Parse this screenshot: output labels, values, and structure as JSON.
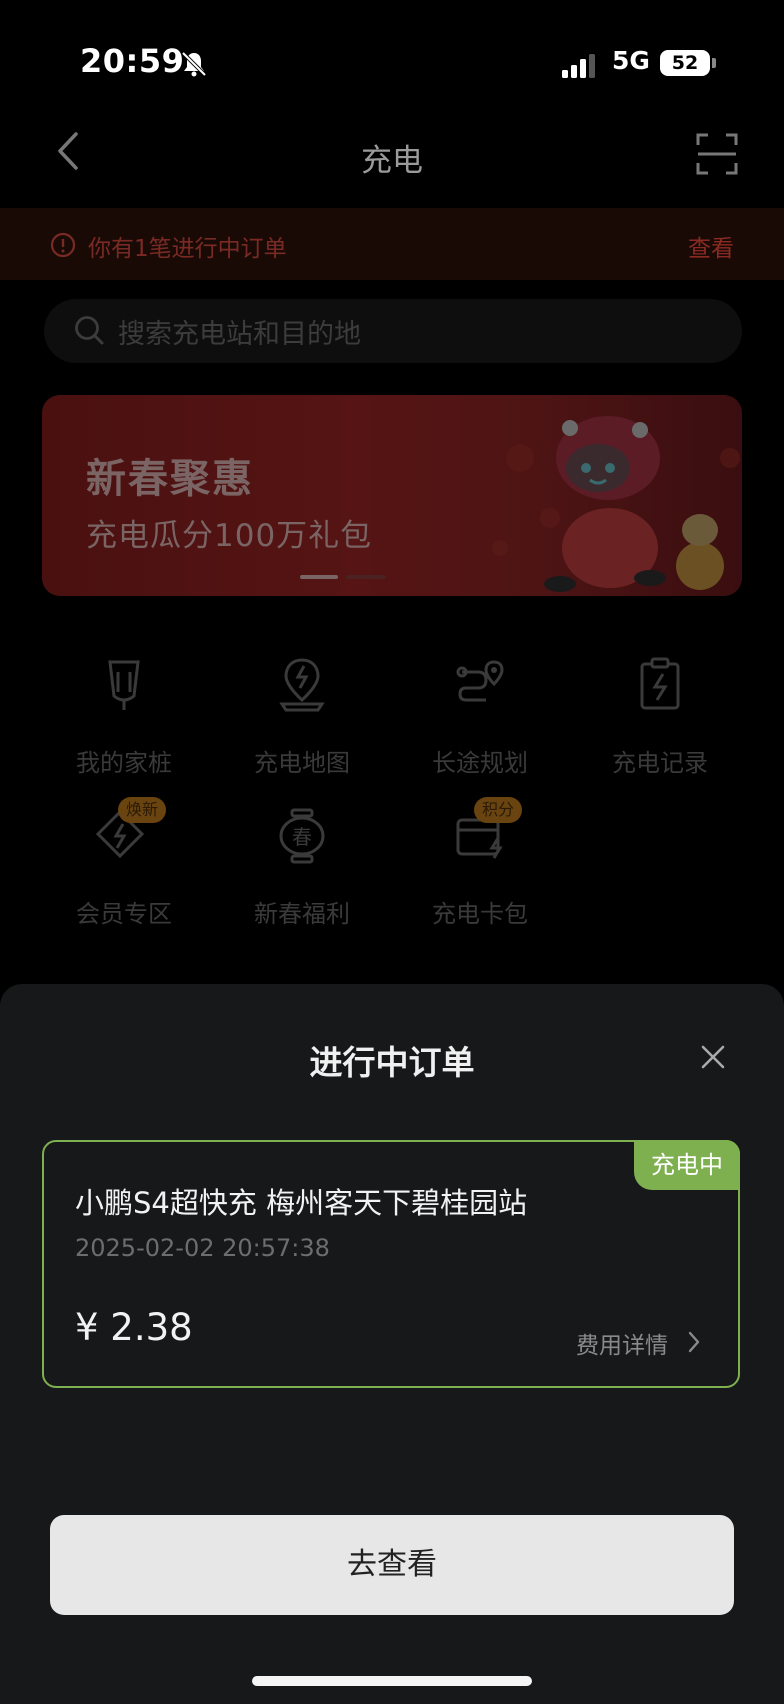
{
  "status": {
    "time": "20:59",
    "network": "5G",
    "battery": "52"
  },
  "header": {
    "title": "充电"
  },
  "notice": {
    "text": "你有1笔进行中订单",
    "link": "查看"
  },
  "search": {
    "placeholder": "搜索充电站和目的地"
  },
  "banner": {
    "title": "新春聚惠",
    "subtitle": "充电瓜分100万礼包"
  },
  "grid": {
    "items": [
      {
        "label": "我的家桩",
        "icon": "home-charger-icon"
      },
      {
        "label": "充电地图",
        "icon": "charging-map-icon"
      },
      {
        "label": "长途规划",
        "icon": "route-plan-icon"
      },
      {
        "label": "充电记录",
        "icon": "charging-record-icon"
      },
      {
        "label": "会员专区",
        "icon": "member-icon",
        "tag": "焕新"
      },
      {
        "label": "新春福利",
        "icon": "spring-lantern-icon"
      },
      {
        "label": "充电卡包",
        "icon": "card-wallet-icon",
        "tag": "积分"
      }
    ]
  },
  "sheet": {
    "title": "进行中订单",
    "order": {
      "status": "充电中",
      "station": "小鹏S4超快充 梅州客天下碧桂园站",
      "time": "2025-02-02 20:57:38",
      "price": "¥ 2.38",
      "detail_link": "费用详情"
    },
    "button": "去查看"
  },
  "colors": {
    "accent_green": "#7fb050",
    "notice_red": "#8a2a22"
  }
}
